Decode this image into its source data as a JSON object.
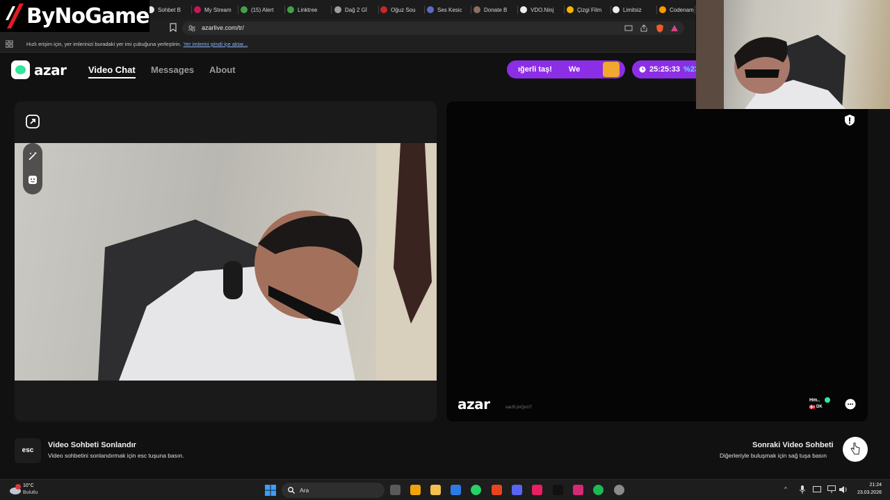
{
  "overlay": {
    "brand": "ByNoGame"
  },
  "browser": {
    "tabs": [
      {
        "label": "Sohbet B",
        "color": "#e8e8e8"
      },
      {
        "label": "My Stream",
        "color": "#c2185b"
      },
      {
        "label": "(15) Alert",
        "color": "#43a047"
      },
      {
        "label": "Linktree",
        "color": "#43a047"
      },
      {
        "label": "Dağ 2 Gİ",
        "color": "#9e9e9e"
      },
      {
        "label": "Oğuz Sou",
        "color": "#c62828"
      },
      {
        "label": "Ses Kesic",
        "color": "#5c6bc0"
      },
      {
        "label": "Donate B",
        "color": "#8d6e63"
      },
      {
        "label": "VDO.Ninj",
        "color": "#eeeeee"
      },
      {
        "label": "Çizgi Film",
        "color": "#ffb300"
      },
      {
        "label": "Limitsiz",
        "color": "#eeeeee"
      },
      {
        "label": "Codenam",
        "color": "#ff9800"
      }
    ],
    "url": "azarlive.com/tr/",
    "bookmark_prompt": "Hızlı erişim için, yer imlerinizi buradaki yer imi çubuğuna yerleştirin.",
    "bookmark_link": "Yer imlerini şimdi içe aktar..."
  },
  "app": {
    "logo": "azar",
    "nav": [
      "Video Chat",
      "Messages",
      "About"
    ],
    "promo_text": "ığerli taş!",
    "promo_text2": "We",
    "timer": "25:25:33",
    "timer_pct": "%23",
    "remote_logo": "azar",
    "remote_id": "oaU5 jmQuU7",
    "remote_user": "Hm..",
    "remote_country": "DK",
    "end_title": "Video Sohbeti Sonlandır",
    "end_sub": "Video sohbetini sonlandırmak için esc tuşuna basın.",
    "esc_key": "esc",
    "next_title": "Sonraki Video Sohbeti",
    "next_sub": "Diğerleriyle buluşmak için sağ tuşa basın"
  },
  "taskbar": {
    "weather_temp": "10°C",
    "weather_desc": "Bulutlu",
    "search": "Ara",
    "time": "21:24",
    "date": "23.03.2026",
    "app_colors": [
      "#0a84ff",
      "#5a5a5a",
      "#f0a30a",
      "#f2c14e",
      "#2d7be5",
      "#25d366",
      "#e8441e",
      "#5865f2",
      "#e91e63",
      "#111111",
      "#d62976",
      "#1db954",
      "#8a8a8a"
    ]
  },
  "colors": {
    "accent": "#8c2ee6",
    "brand_green": "#31e79a"
  }
}
